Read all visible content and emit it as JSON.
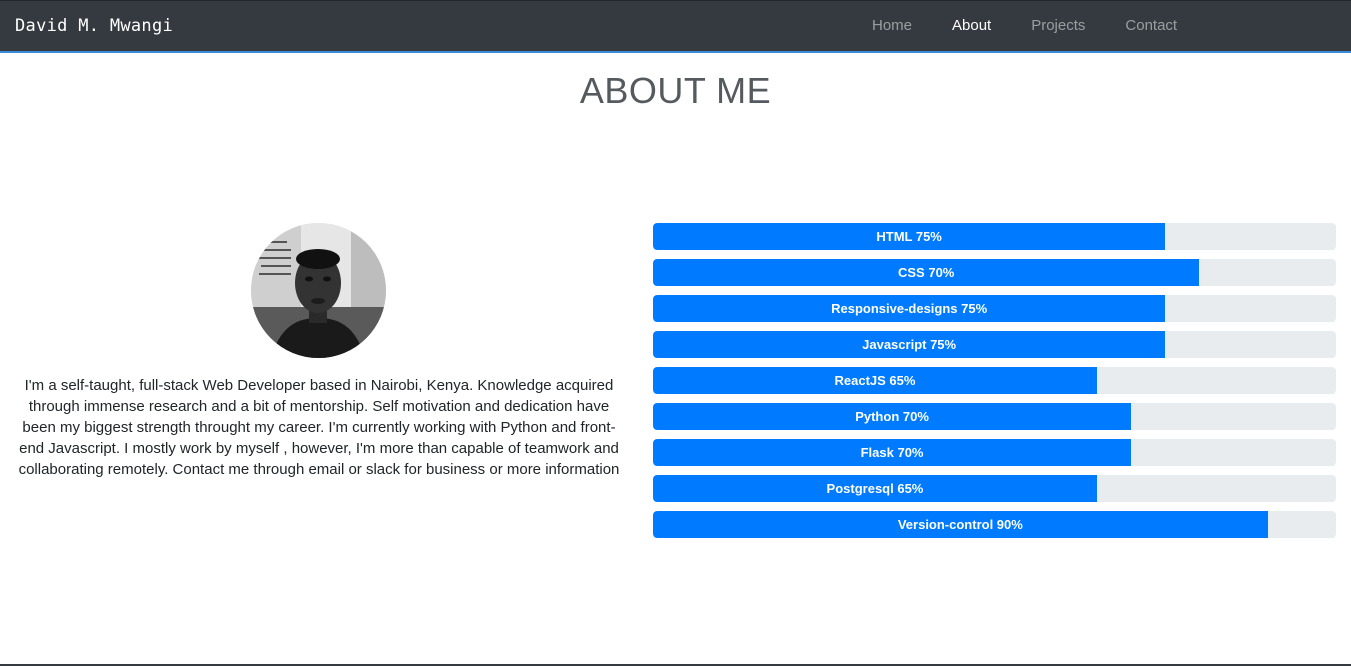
{
  "navbar": {
    "brand": "David M. Mwangi",
    "links": [
      {
        "label": "Home",
        "active": false
      },
      {
        "label": "About",
        "active": true
      },
      {
        "label": "Projects",
        "active": false
      },
      {
        "label": "Contact",
        "active": false
      }
    ]
  },
  "page": {
    "title": "ABOUT ME",
    "bio": "I'm a self-taught, full-stack Web Developer based in Nairobi, Kenya. Knowledge acquired through immense research and a bit of mentorship. Self motivation and dedication have been my biggest strength throught my career. I'm currently working with Python and front-end Javascript. I mostly work by myself , however, I'm more than capable of teamwork and collaborating remotely. Contact me through email or slack for business or more information"
  },
  "skills": [
    {
      "label": "HTML 75%",
      "percent": 75
    },
    {
      "label": "CSS 70%",
      "percent": 80
    },
    {
      "label": "Responsive-designs 75%",
      "percent": 75
    },
    {
      "label": "Javascript 75%",
      "percent": 75
    },
    {
      "label": "ReactJS 65%",
      "percent": 65
    },
    {
      "label": "Python 70%",
      "percent": 70
    },
    {
      "label": "Flask 70%",
      "percent": 70
    },
    {
      "label": "Postgresql 65%",
      "percent": 65
    },
    {
      "label": "Version-control 90%",
      "percent": 90
    }
  ],
  "colors": {
    "navbar_bg": "#343a40",
    "accent": "#007bff",
    "progress_track": "#e9ecef"
  }
}
